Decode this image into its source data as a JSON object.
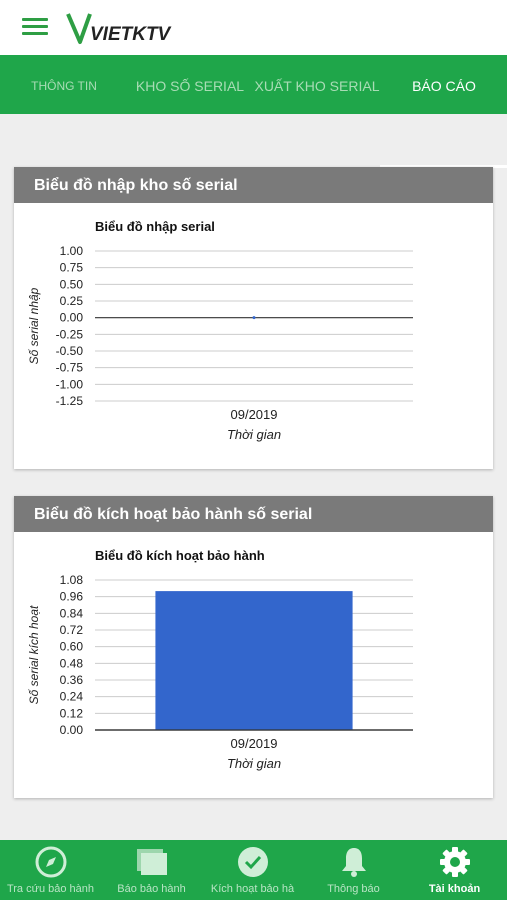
{
  "brand": {
    "logo_text": "VIETKTV"
  },
  "tabs": [
    {
      "label": "THÔNG TIN",
      "active": false
    },
    {
      "label": "KHO SỐ SERIAL",
      "active": false
    },
    {
      "label": "XUẤT KHO SERIAL",
      "active": false
    },
    {
      "label": "BÁO CÁO",
      "active": true
    }
  ],
  "colors": {
    "primary": "#1fa64a",
    "card_header": "#7a7a7a",
    "bar": "#3366cc"
  },
  "cards": [
    {
      "title": "Biểu đồ nhập kho số serial"
    },
    {
      "title": "Biểu đồ kích hoạt bảo hành số serial"
    }
  ],
  "chart_data": [
    {
      "type": "line",
      "title": "Biểu đồ nhập serial",
      "xlabel": "Thời gian",
      "ylabel": "Số serial nhập",
      "categories": [
        "09/2019"
      ],
      "series": [
        {
          "values": [
            0
          ]
        }
      ],
      "yticks": [
        "1.00",
        "0.75",
        "0.50",
        "0.25",
        "0.00",
        "-0.25",
        "-0.50",
        "-0.75",
        "-1.00",
        "-1.25"
      ],
      "ylim": [
        -1.25,
        1.0
      ],
      "grid": true
    },
    {
      "type": "bar",
      "title": "Biểu đồ kích hoạt bảo hành",
      "xlabel": "Thời gian",
      "ylabel": "Số serial kích hoạt",
      "categories": [
        "09/2019"
      ],
      "values": [
        1
      ],
      "yticks": [
        "1.08",
        "0.96",
        "0.84",
        "0.72",
        "0.60",
        "0.48",
        "0.36",
        "0.24",
        "0.12",
        "0.00"
      ],
      "ylim": [
        0,
        1.08
      ],
      "grid": true
    }
  ],
  "bottom_nav": [
    {
      "label": "Tra cứu bảo hành",
      "icon": "compass-icon",
      "active": false
    },
    {
      "label": "Báo bảo hành",
      "icon": "cards-icon",
      "active": false
    },
    {
      "label": "Kích hoạt bảo hà",
      "icon": "check-circle-icon",
      "active": false
    },
    {
      "label": "Thông báo",
      "icon": "bell-icon",
      "active": false
    },
    {
      "label": "Tài khoản",
      "icon": "gear-icon",
      "active": true
    }
  ]
}
